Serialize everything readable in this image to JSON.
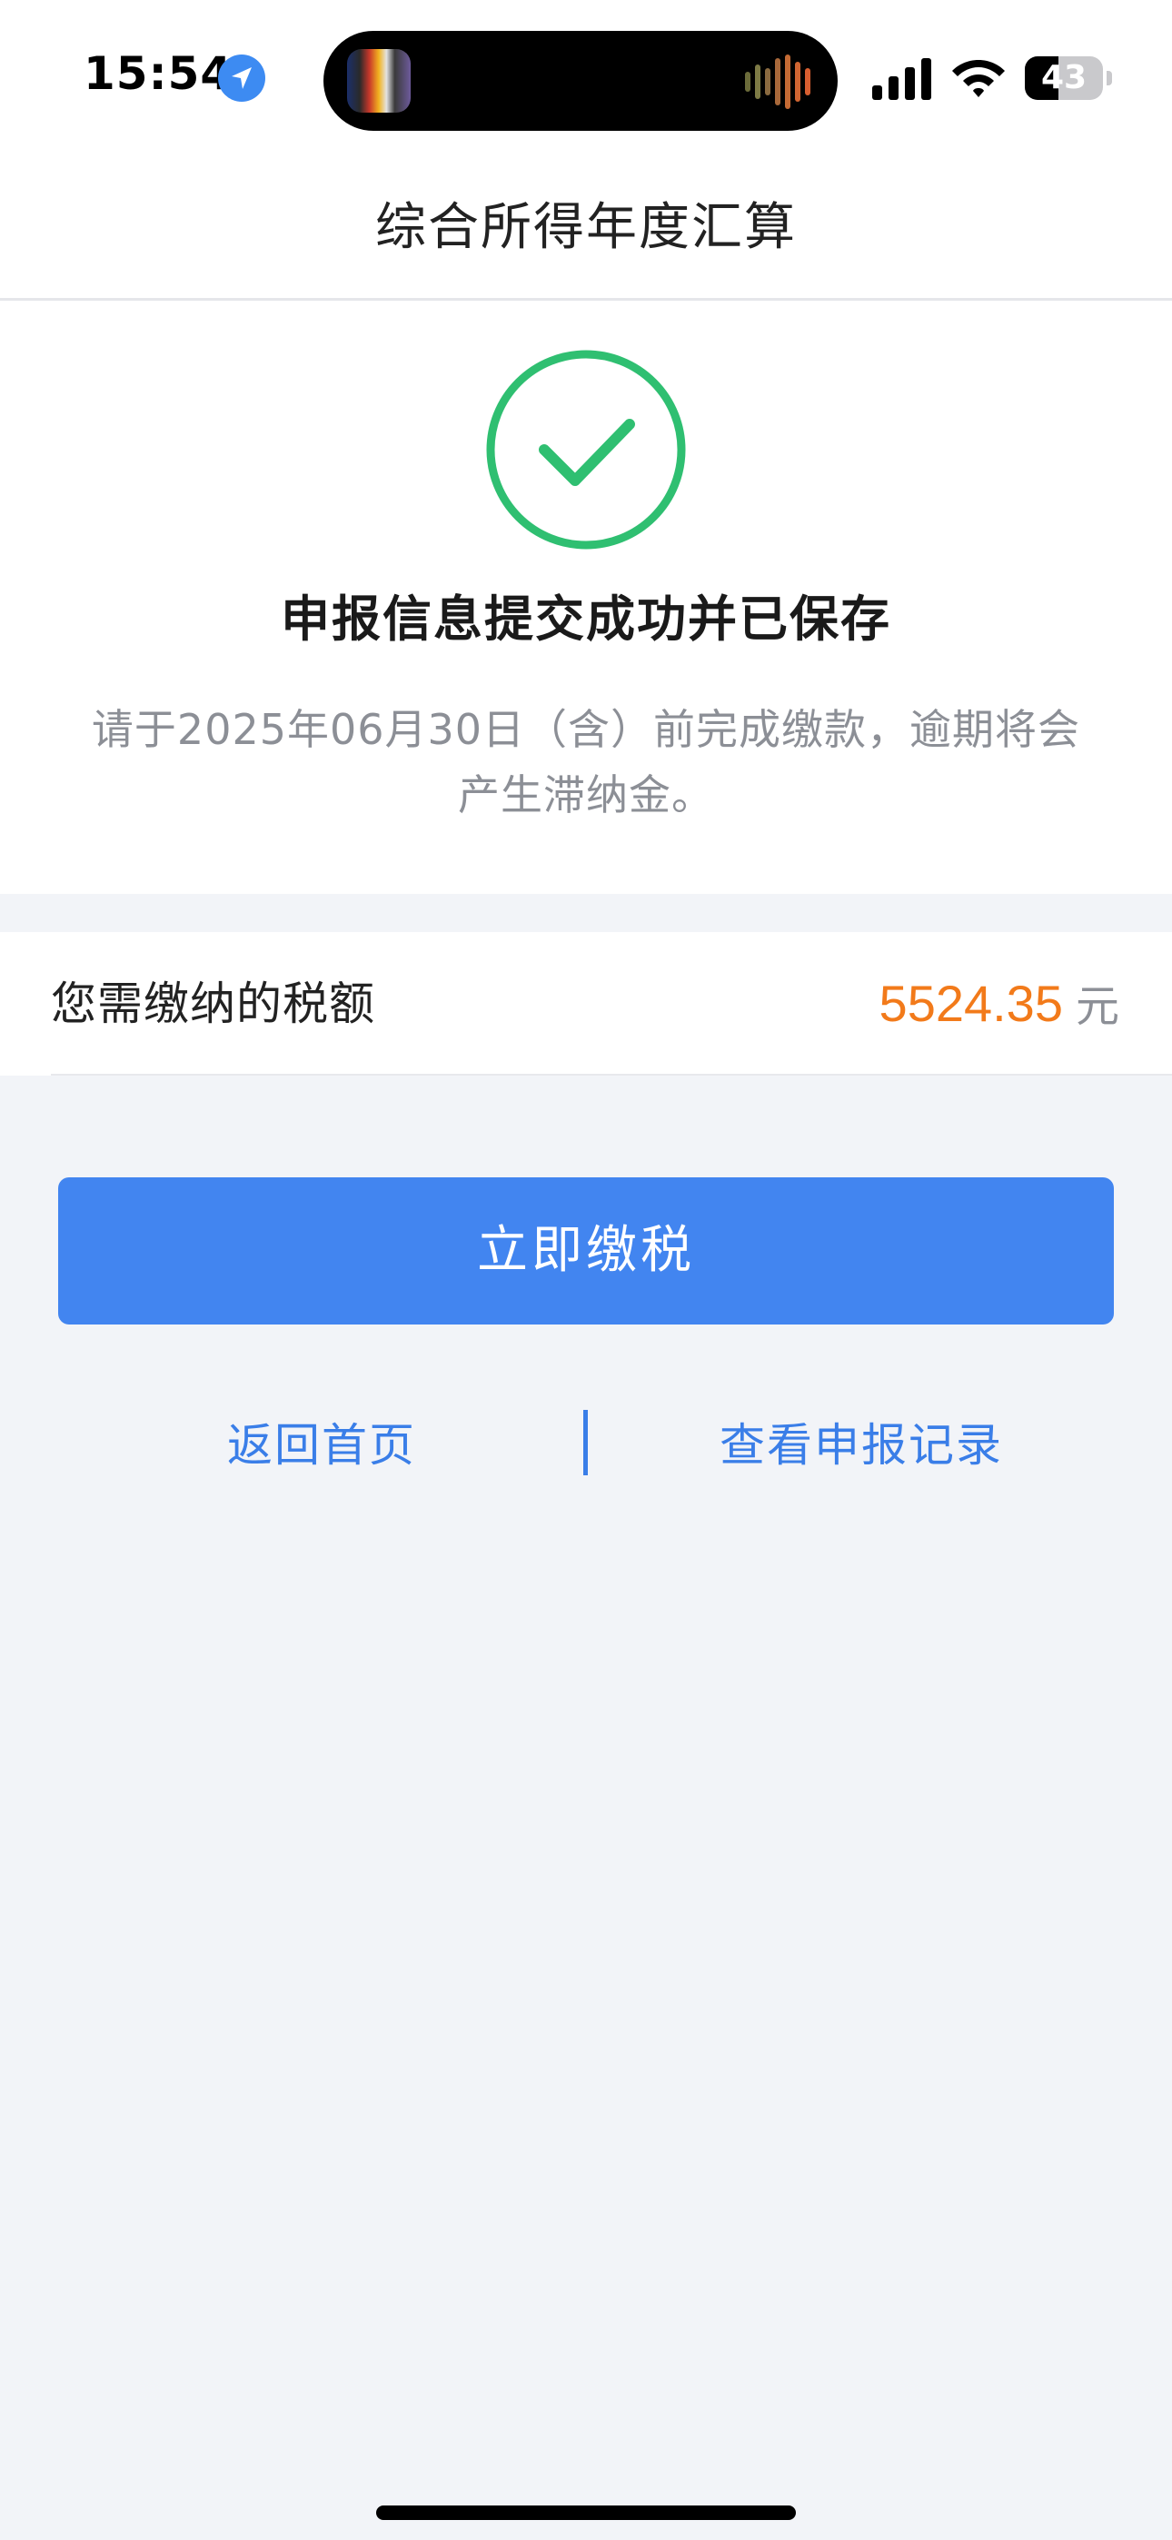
{
  "status_bar": {
    "time": "15:54",
    "battery_level": "43",
    "icons": [
      "location-arrow-icon",
      "signal-bars-icon",
      "wifi-icon",
      "battery-icon"
    ]
  },
  "header": {
    "title": "综合所得年度汇算"
  },
  "result": {
    "icon": "check-circle-icon",
    "title": "申报信息提交成功并已保存",
    "note": "请于2025年06月30日（含）前完成缴款，逾期将会产生滞纳金。"
  },
  "tax": {
    "label": "您需缴纳的税额",
    "amount": "5524.35",
    "unit": "元"
  },
  "actions": {
    "pay_label": "立即缴税",
    "home_label": "返回首页",
    "records_label": "查看申报记录"
  },
  "colors": {
    "primary": "#4285f0",
    "success": "#2fbf71",
    "amount": "#f27a1a",
    "link": "#3a7ee8"
  }
}
